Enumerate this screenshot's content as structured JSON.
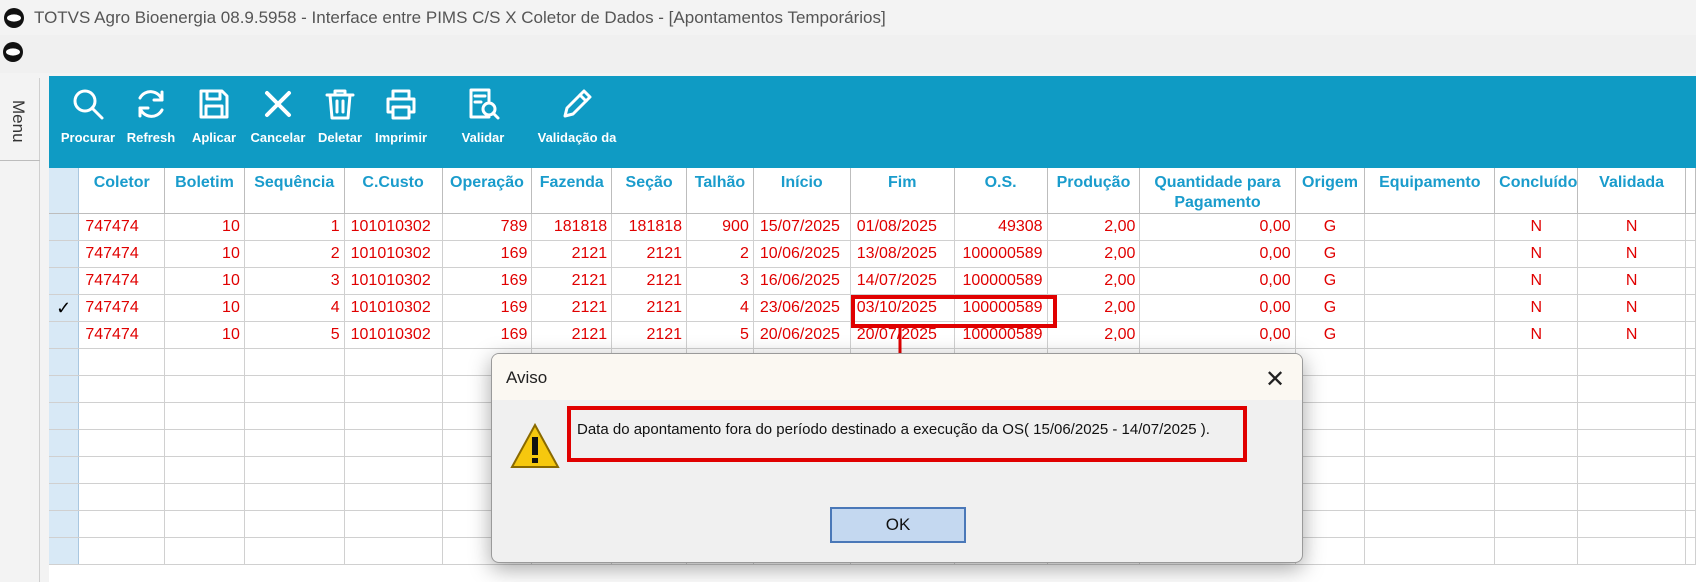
{
  "window": {
    "title": "TOTVS Agro Bioenergia 08.9.5958 - Interface entre PIMS C/S X Coletor de Dados - [Apontamentos Temporários]"
  },
  "sidemenu": {
    "label": "Menu"
  },
  "toolbar": {
    "buttons": [
      {
        "label": "Procurar",
        "icon": "search-icon"
      },
      {
        "label": "Refresh",
        "icon": "refresh-icon"
      },
      {
        "label": "Aplicar",
        "icon": "save-icon"
      },
      {
        "label": "Cancelar",
        "icon": "close-icon"
      },
      {
        "label": "Deletar",
        "icon": "trash-icon"
      },
      {
        "label": "Imprimir",
        "icon": "printer-icon"
      },
      {
        "label": "Validar",
        "icon": "validate-doc-icon"
      },
      {
        "label": "Validação da",
        "icon": "pencil-icon"
      }
    ]
  },
  "grid": {
    "columns": [
      "Coletor",
      "Boletim",
      "Sequência",
      "C.Custo",
      "Operação",
      "Fazenda",
      "Seção",
      "Talhão",
      "Início",
      "Fim",
      "O.S.",
      "Produção",
      "Quantidade para Pagamento",
      "Origem",
      "Equipamento",
      "Concluído",
      "Validada"
    ],
    "rows": [
      [
        "747474",
        "10",
        "1",
        "101010302",
        "789",
        "181818",
        "181818",
        "900",
        "15/07/2025",
        "01/08/2025",
        "49308",
        "2,00",
        "0,00",
        "G",
        "",
        "N",
        "N"
      ],
      [
        "747474",
        "10",
        "2",
        "101010302",
        "169",
        "2121",
        "2121",
        "2",
        "10/06/2025",
        "13/08/2025",
        "100000589",
        "2,00",
        "0,00",
        "G",
        "",
        "N",
        "N"
      ],
      [
        "747474",
        "10",
        "3",
        "101010302",
        "169",
        "2121",
        "2121",
        "3",
        "16/06/2025",
        "14/07/2025",
        "100000589",
        "2,00",
        "0,00",
        "G",
        "",
        "N",
        "N"
      ],
      [
        "747474",
        "10",
        "4",
        "101010302",
        "169",
        "2121",
        "2121",
        "4",
        "23/06/2025",
        "03/10/2025",
        "100000589",
        "2,00",
        "0,00",
        "G",
        "",
        "N",
        "N"
      ],
      [
        "747474",
        "10",
        "5",
        "101010302",
        "169",
        "2121",
        "2121",
        "5",
        "20/06/2025",
        "20/07/2025",
        "100000589",
        "2,00",
        "0,00",
        "G",
        "",
        "N",
        "N"
      ]
    ],
    "selected_row_marker": "✓",
    "selected_row_index": 3
  },
  "dialog": {
    "title": "Aviso",
    "close": "✕",
    "message": "Data do apontamento fora do período destinado a execução da OS( 15/06/2025 - 14/07/2025 ).",
    "ok_label": "OK"
  },
  "colors": {
    "toolbar": "#0f9bc4",
    "header_text": "#1a9ccc",
    "cell_text": "#e00000",
    "annotation": "#e00000"
  }
}
